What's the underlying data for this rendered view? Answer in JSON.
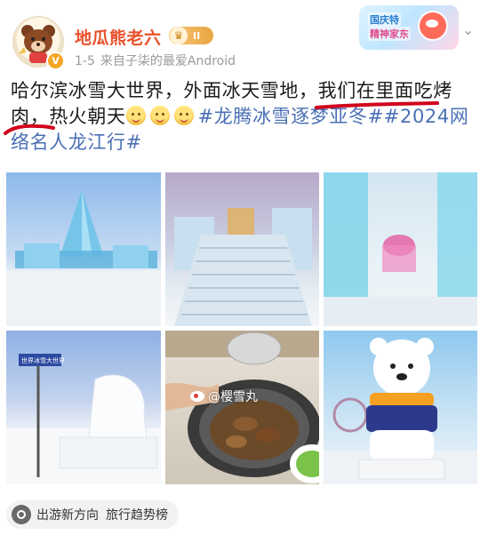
{
  "header": {
    "username": "地瓜熊老六",
    "level_badge": "II",
    "meta": {
      "date": "1-5",
      "source": "来自子柒的最爱Android"
    },
    "event_banner": {
      "line1": "国庆特",
      "line2": "精神家东"
    }
  },
  "post": {
    "text_plain": "哈尔滨冰雪大世界，外面冰天雪地，我们在里面吃烤肉，热火朝天",
    "hashtags": "#龙腾冰雪逐梦亚冬##2024网络名人龙江行#",
    "emoji_count": 3,
    "annotation_color": "#d0021b"
  },
  "photos": {
    "watermark": "@樱雪丸",
    "street_sign": "世界冰雪大世界"
  },
  "topic_chip": {
    "label1": "出游新方向",
    "label2": "旅行趋势榜"
  },
  "colors": {
    "username": "#e8502a",
    "hashtag": "#4a6fb5",
    "meta": "#9a9a9a"
  }
}
